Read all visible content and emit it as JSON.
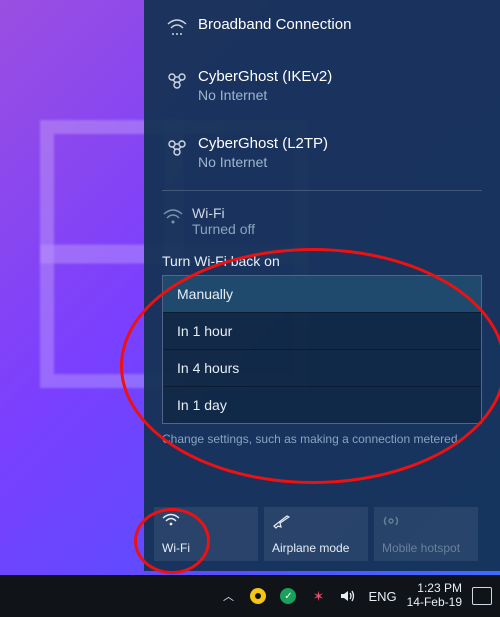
{
  "connections": [
    {
      "name": "Broadband Connection",
      "sub": "",
      "icon": "broadband"
    },
    {
      "name": "CyberGhost (IKEv2)",
      "sub": "No Internet",
      "icon": "vpn"
    },
    {
      "name": "CyberGhost (L2TP)",
      "sub": "No Internet",
      "icon": "vpn"
    }
  ],
  "wifi_section": {
    "title": "Wi-Fi",
    "status": "Turned off"
  },
  "turn_back_label": "Turn Wi-Fi back on",
  "options": [
    {
      "label": "Manually",
      "selected": true
    },
    {
      "label": "In 1 hour",
      "selected": false
    },
    {
      "label": "In 4 hours",
      "selected": false
    },
    {
      "label": "In 1 day",
      "selected": false
    }
  ],
  "settings_hint": "Change settings, such as making a connection metered.",
  "tiles": {
    "wifi": "Wi-Fi",
    "airplane": "Airplane mode",
    "hotspot": "Mobile hotspot"
  },
  "taskbar": {
    "lang": "ENG",
    "time": "1:23 PM",
    "date": "14-Feb-19"
  }
}
